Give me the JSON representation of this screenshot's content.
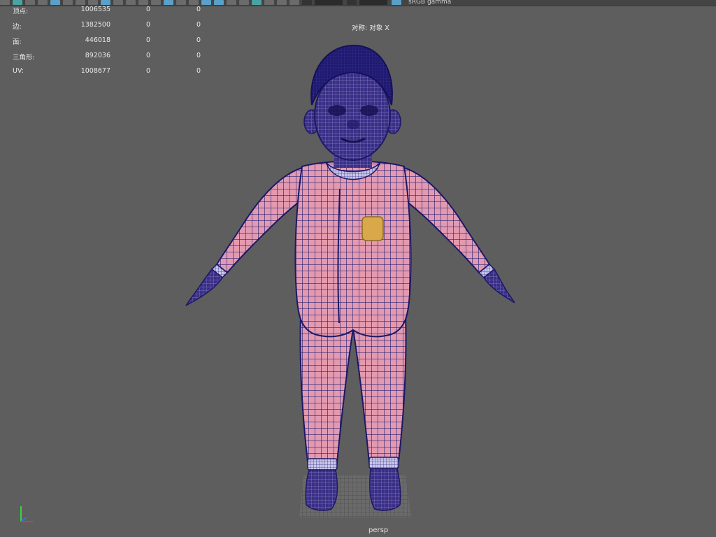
{
  "hud": {
    "rows": [
      {
        "label": "顶点:",
        "v1": "1006535",
        "v2": "0",
        "v3": "0"
      },
      {
        "label": "边:",
        "v1": "1382500",
        "v2": "0",
        "v3": "0"
      },
      {
        "label": "面:",
        "v1": "446018",
        "v2": "0",
        "v3": "0"
      },
      {
        "label": "三角形:",
        "v1": "892036",
        "v2": "0",
        "v3": "0"
      },
      {
        "label": "UV:",
        "v1": "1008677",
        "v2": "0",
        "v3": "0"
      }
    ]
  },
  "viewport": {
    "object_label": "对称: 对象 X",
    "camera_label": "persp",
    "background": "#5e5e5e",
    "colors": {
      "skin": "#3a2f86",
      "wire": "#1c1866",
      "suit": "#e39ab0",
      "patch": "#d8a84a",
      "cuff": "#c8c6e8"
    }
  },
  "toolbar": {
    "label": "sRGB gamma"
  },
  "axis": {
    "icon": "xyz-axis-gizmo-icon",
    "x": "x",
    "y": "y",
    "z": "z"
  }
}
